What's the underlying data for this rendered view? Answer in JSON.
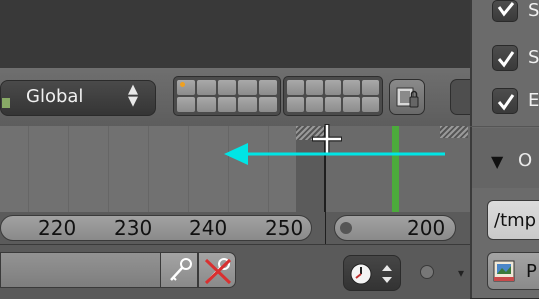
{
  "header": {
    "transform_orientation": {
      "value": "Global",
      "arrows": "▲\n▼"
    }
  },
  "timeline": {
    "ruler_ticks": [
      "220",
      "230",
      "240",
      "250"
    ],
    "current_frame": "200"
  },
  "properties_panel": {
    "checkbox_labels": [
      "S",
      "S",
      "E"
    ],
    "section_title": "O",
    "output_path": "/tmp",
    "play_label": "P"
  },
  "colors": {
    "playhead": "#4caa3c",
    "annotation_arrow": "#00e5e5",
    "active_layer_dot": "#f0a020",
    "keying_delete_x": "#d93030"
  }
}
